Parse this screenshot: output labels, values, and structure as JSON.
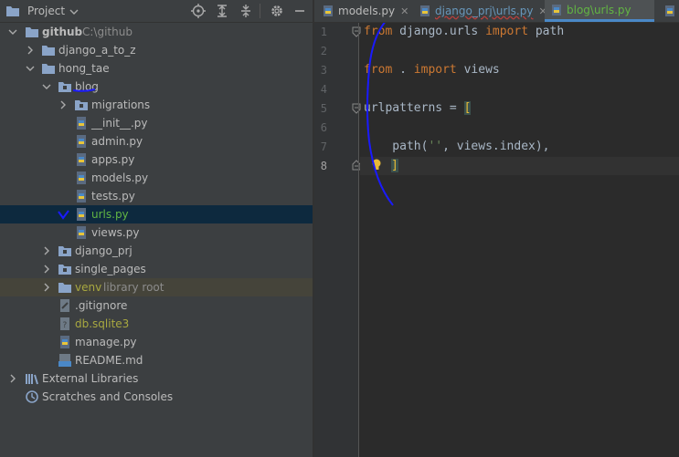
{
  "project_panel": {
    "title": "Project",
    "tree": [
      {
        "label": "github",
        "hint": "C:\\github",
        "bold": true
      },
      {
        "label": "django_a_to_z"
      },
      {
        "label": "hong_tae"
      },
      {
        "label": "blog"
      },
      {
        "label": "migrations"
      },
      {
        "label": "__init__.py"
      },
      {
        "label": "admin.py"
      },
      {
        "label": "apps.py"
      },
      {
        "label": "models.py"
      },
      {
        "label": "tests.py"
      },
      {
        "label": "urls.py"
      },
      {
        "label": "views.py"
      },
      {
        "label": "django_prj"
      },
      {
        "label": "single_pages"
      },
      {
        "label": "venv",
        "hint": "library root"
      },
      {
        "label": ".gitignore"
      },
      {
        "label": "db.sqlite3"
      },
      {
        "label": "manage.py"
      },
      {
        "label": "README.md"
      },
      {
        "label": "External Libraries"
      },
      {
        "label": "Scratches and Consoles"
      }
    ]
  },
  "tabs": [
    {
      "label": "models.py"
    },
    {
      "label": "django_prj\\urls.py"
    },
    {
      "label": "blog\\urls.py"
    }
  ],
  "editor": {
    "line_numbers": [
      "1",
      "2",
      "3",
      "4",
      "5",
      "6",
      "7",
      "8"
    ],
    "line1": {
      "kw1": "from",
      "mod": " django.urls ",
      "kw2": "import",
      "name": " path"
    },
    "line3": {
      "kw1": "from",
      "mod": " . ",
      "kw2": "import",
      "name": " views"
    },
    "line5": {
      "name": "urlpatterns = ",
      "bracket": "["
    },
    "line7": {
      "pre": "    path(",
      "str": "''",
      "mid": ", views.index),"
    },
    "line8": {
      "bracket": "]"
    }
  },
  "colors": {
    "accent": "#4a88c7",
    "selected_row": "#0d293e",
    "annotation": "#1a1aff"
  }
}
